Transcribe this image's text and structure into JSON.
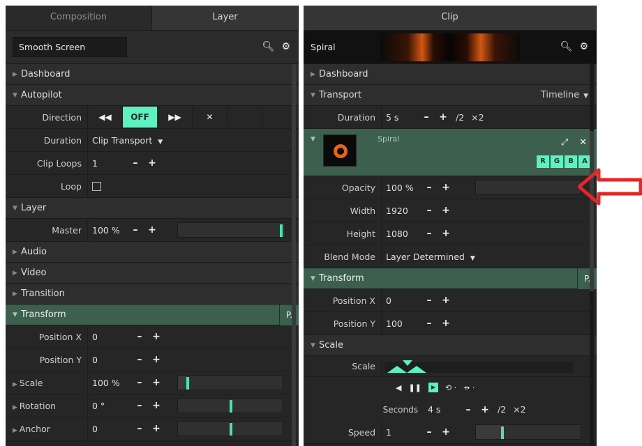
{
  "left": {
    "tabs": [
      "Composition",
      "Layer"
    ],
    "composition_name": "Smooth Screen",
    "sections": {
      "dashboard": "Dashboard",
      "autopilot": "Autopilot",
      "layer": "Layer",
      "audio": "Audio",
      "video": "Video",
      "transition": "Transition",
      "transform": "Transform"
    },
    "transform_badge": "P.",
    "autopilot": {
      "direction_label": "Direction",
      "direction_buttons": [
        "◀◀",
        "OFF",
        "▶▶",
        "✕"
      ],
      "duration_label": "Duration",
      "duration_value": "Clip Transport",
      "clip_loops_label": "Clip Loops",
      "clip_loops_value": "1",
      "loop_label": "Loop"
    },
    "master": {
      "label": "Master",
      "value": "100 %"
    },
    "transform": {
      "position_x_label": "Position X",
      "position_x_value": "0",
      "position_y_label": "Position Y",
      "position_y_value": "0",
      "scale_label": "Scale",
      "scale_value": "100 %",
      "rotation_label": "Rotation",
      "rotation_value": "0 °",
      "anchor_label": "Anchor",
      "anchor_value": "0"
    }
  },
  "right": {
    "tab": "Clip",
    "clip_name": "Spiral",
    "sections": {
      "dashboard": "Dashboard",
      "transport": "Transport",
      "transform": "Transform",
      "scale": "Scale"
    },
    "transport_mode": "Timeline",
    "duration": {
      "label": "Duration",
      "value": "5 s",
      "half": "/2",
      "double": "×2"
    },
    "card_name": "Spiral",
    "rgba": [
      "R",
      "G",
      "B",
      "A"
    ],
    "opacity": {
      "label": "Opacity",
      "value": "100 %"
    },
    "width": {
      "label": "Width",
      "value": "1920"
    },
    "height": {
      "label": "Height",
      "value": "1080"
    },
    "blend": {
      "label": "Blend Mode",
      "value": "Layer Determined"
    },
    "transform_badge": "P.",
    "position_x": {
      "label": "Position X",
      "value": "0"
    },
    "position_y": {
      "label": "Position Y",
      "value": "100"
    },
    "scale": {
      "label": "Scale",
      "seconds_label": "Seconds",
      "seconds_value": "4 s",
      "half": "/2",
      "double": "×2"
    },
    "speed": {
      "label": "Speed",
      "value": "1"
    }
  },
  "symbols": {
    "minus": "–",
    "plus": "+",
    "search": "🔍",
    "gear": "⚙",
    "expand": "⤢",
    "close": "✕"
  },
  "annotation_color": "#e32626",
  "accent_color": "#5df0c0"
}
